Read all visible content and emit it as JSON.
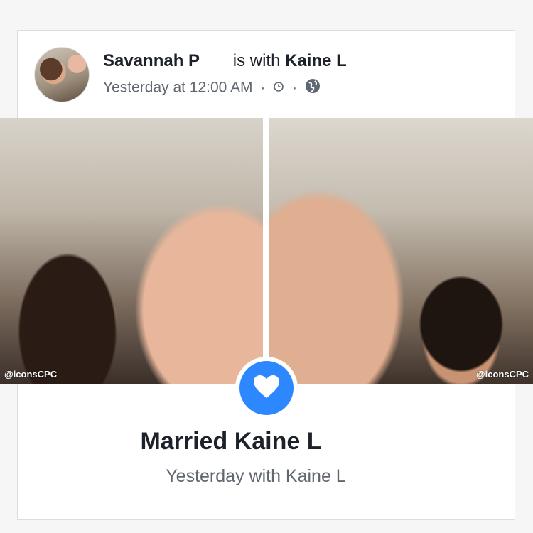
{
  "post": {
    "author": "Savannah P",
    "with_text": "is with",
    "tagged": "Kaine L",
    "timestamp": "Yesterday at 12:00 AM",
    "dot": "·",
    "icons": [
      "clock-icon",
      "globe-icon"
    ]
  },
  "photos": {
    "left_watermark": "@iconsCPC",
    "right_watermark": "@iconsCPC"
  },
  "life_event": {
    "icon": "heart-icon",
    "title": "Married Kaine L",
    "subtitle": "Yesterday with Kaine L"
  },
  "colors": {
    "accent": "#2d88ff",
    "text_primary": "#1d2129",
    "text_secondary": "#606770"
  }
}
